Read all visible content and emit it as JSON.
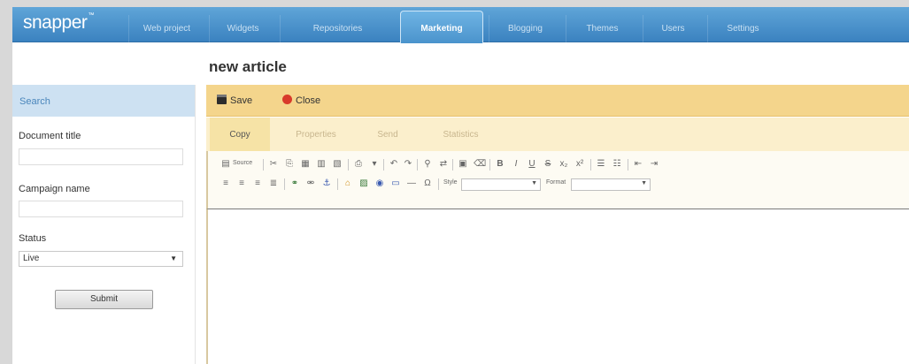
{
  "app": {
    "logo": "snapper",
    "logo_mark": "™"
  },
  "nav": {
    "tabs": [
      {
        "label": "Web project"
      },
      {
        "label": "Widgets"
      },
      {
        "label": "Repositories"
      },
      {
        "label": "Marketing",
        "active": true
      },
      {
        "label": "Blogging"
      },
      {
        "label": "Themes"
      },
      {
        "label": "Users"
      },
      {
        "label": "Settings"
      }
    ]
  },
  "page": {
    "title": "new article"
  },
  "search": {
    "header": "Search",
    "document_title_label": "Document title",
    "document_title_value": "",
    "campaign_name_label": "Campaign name",
    "campaign_name_value": "",
    "status_label": "Status",
    "status_value": "Live",
    "submit_label": "Submit"
  },
  "actions": {
    "save_label": "Save",
    "close_label": "Close"
  },
  "subtabs": [
    {
      "label": "Copy",
      "active": true
    },
    {
      "label": "Properties"
    },
    {
      "label": "Send"
    },
    {
      "label": "Statistics"
    }
  ],
  "toolbar": {
    "source_label": "Source",
    "style_label": "Style",
    "format_label": "Format",
    "style_value": "",
    "format_value": ""
  },
  "colors": {
    "nav_bar": "#3b82c0",
    "action_bar": "#f4d58c",
    "search_header": "#cde1f2"
  }
}
